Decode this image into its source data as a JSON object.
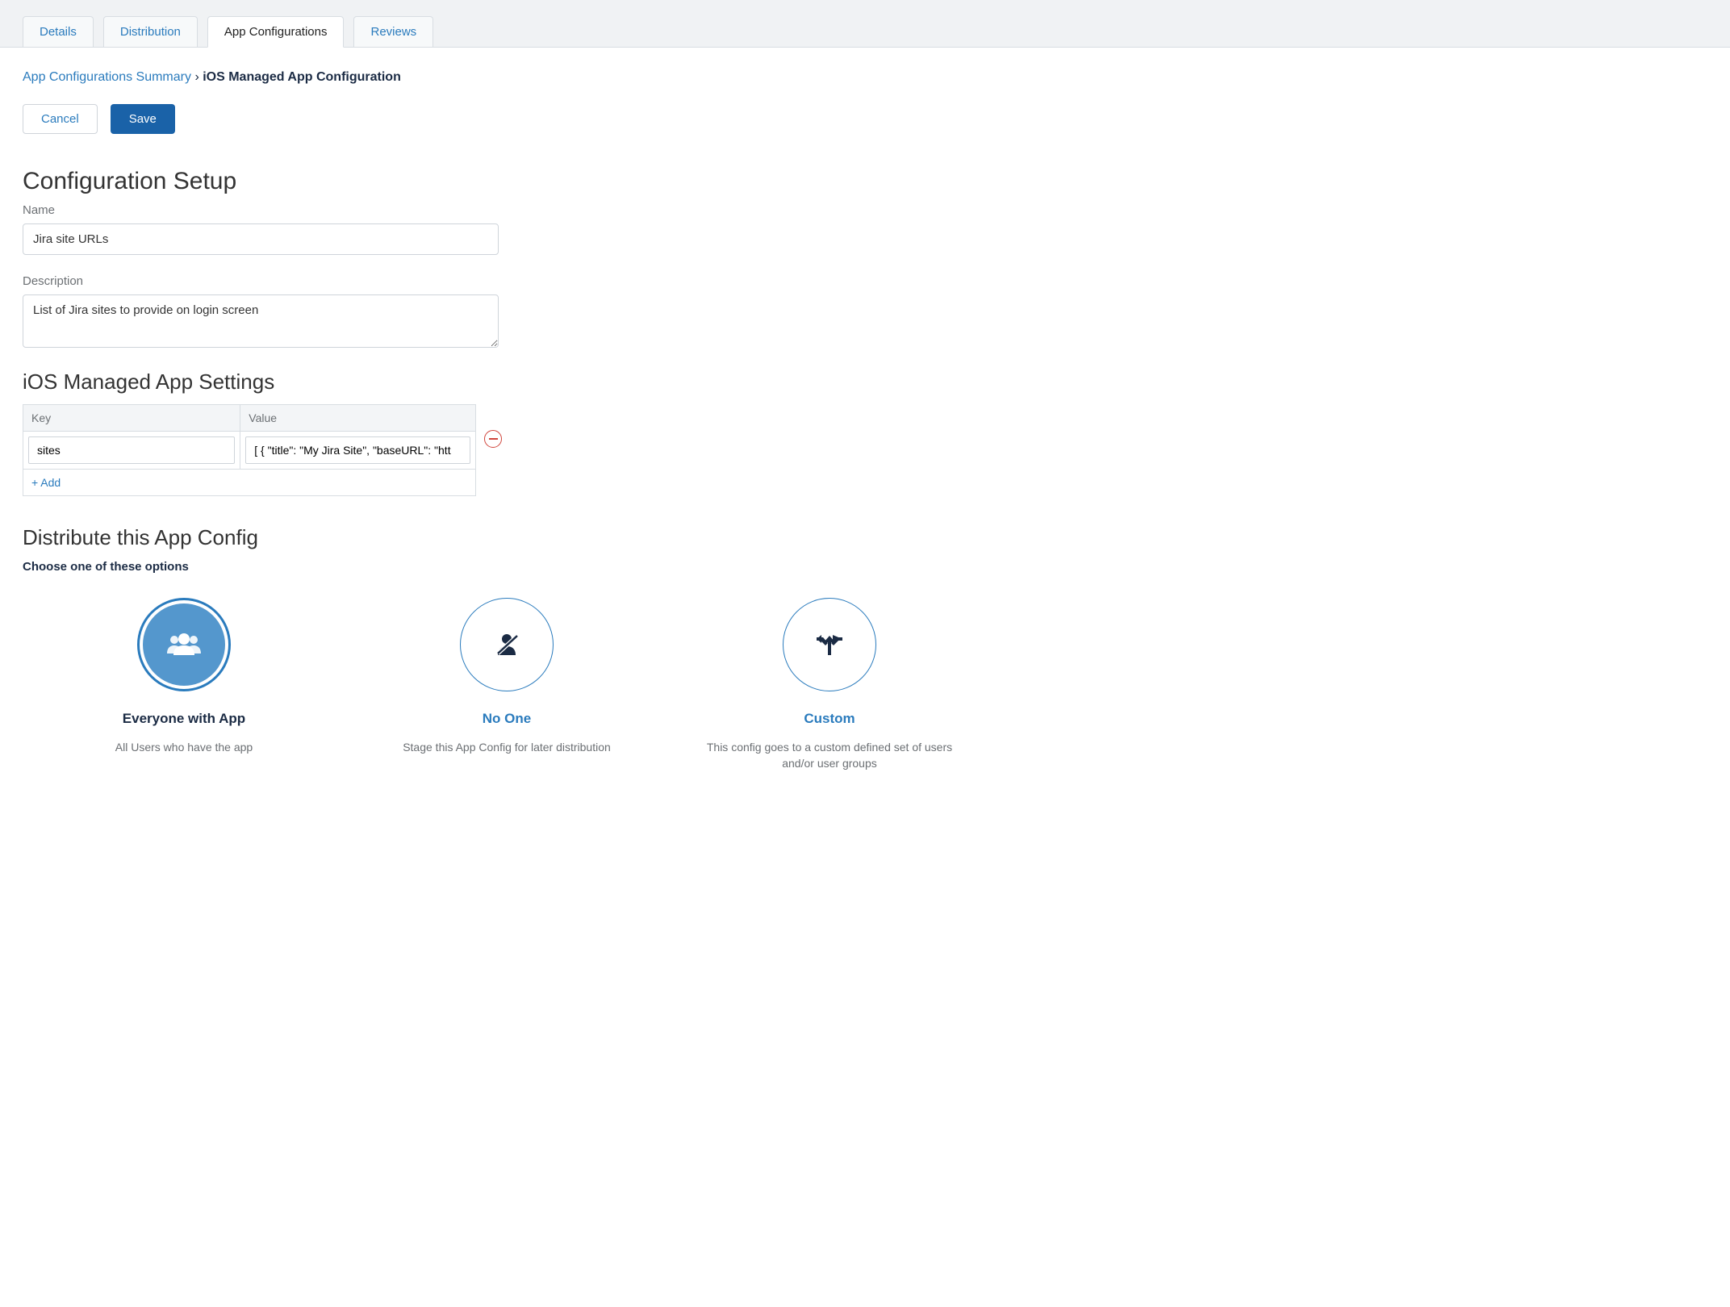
{
  "tabs": {
    "details": "Details",
    "distribution": "Distribution",
    "app_configurations": "App Configurations",
    "reviews": "Reviews"
  },
  "breadcrumb": {
    "summary": "App Configurations Summary",
    "separator": "›",
    "current": "iOS Managed App Configuration"
  },
  "buttons": {
    "cancel": "Cancel",
    "save": "Save"
  },
  "headings": {
    "configuration_setup": "Configuration Setup",
    "ios_settings": "iOS Managed App Settings",
    "distribute": "Distribute this App Config",
    "distribute_sub": "Choose one of these options"
  },
  "fields": {
    "name_label": "Name",
    "name_value": "Jira site URLs",
    "description_label": "Description",
    "description_value": "List of Jira sites to provide on login screen"
  },
  "settings_table": {
    "header_key": "Key",
    "header_value": "Value",
    "rows": [
      {
        "key": "sites",
        "value": "[ { \"title\": \"My Jira Site\", \"baseURL\": \"htt"
      }
    ],
    "add_label": "+ Add"
  },
  "distribute_options": {
    "everyone": {
      "title": "Everyone with App",
      "desc": "All Users who have the app"
    },
    "noone": {
      "title": "No One",
      "desc": "Stage this App Config for later distribution"
    },
    "custom": {
      "title": "Custom",
      "desc": "This config goes to a custom defined set of users and/or user groups"
    }
  }
}
